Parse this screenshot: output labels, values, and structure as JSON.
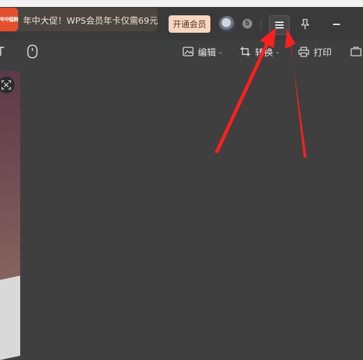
{
  "promo": {
    "badge": "年中猛购",
    "text": "年中大促！WPS会员年卡仅需69元"
  },
  "header": {
    "vip_button": "开通会员"
  },
  "toolbar": {
    "edit_label": "编辑",
    "convert_label": "转换",
    "print_label": "打印"
  },
  "colors": {
    "annotation_arrow": "#ff1f1f",
    "promo_badge": "#e34f2c",
    "vip_button_bg": "#f7d7c2"
  },
  "icons": [
    "crop-icon",
    "pin-icon",
    "hamburger-menu-icon",
    "sync-icon",
    "mouse-icon",
    "image-edit-icon",
    "rotate-icon",
    "printer-icon"
  ]
}
